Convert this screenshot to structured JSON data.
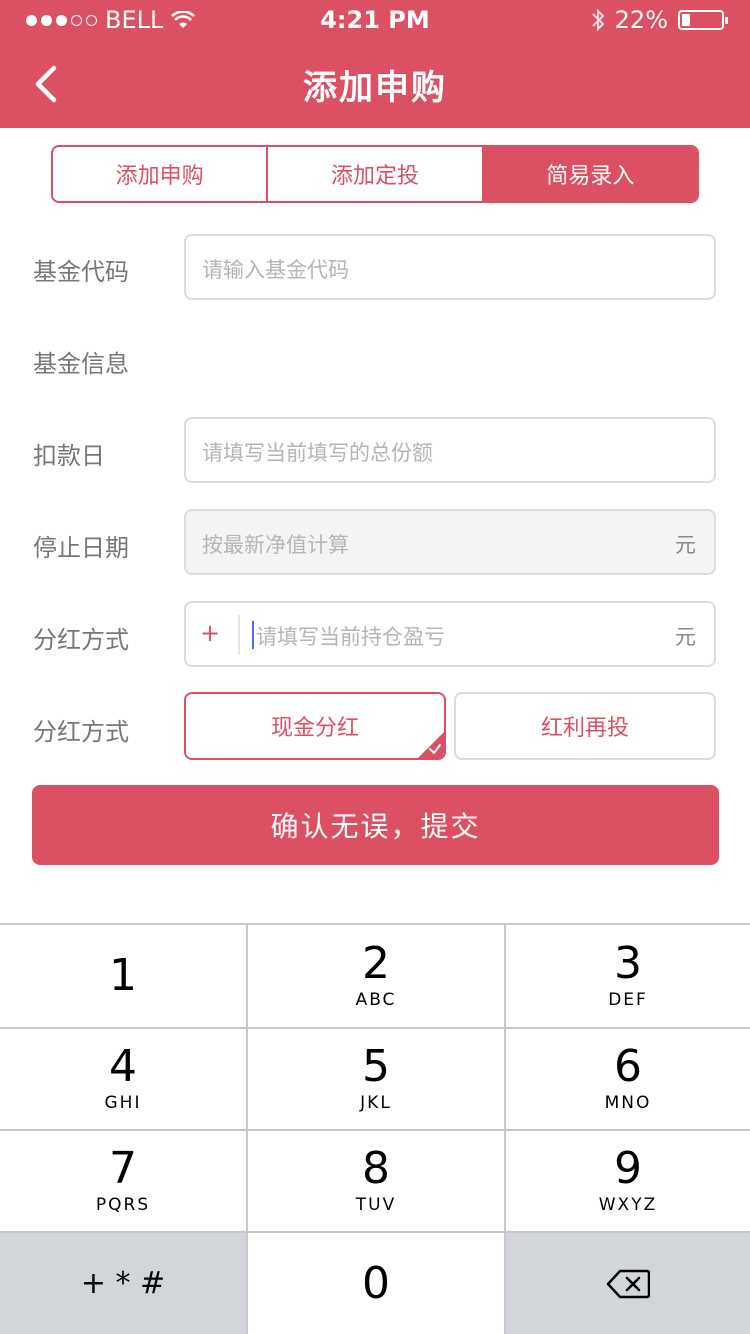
{
  "status_bar": {
    "carrier": "BELL",
    "time": "4:21 PM",
    "battery_text": "22%",
    "battery_level": 0.22
  },
  "nav": {
    "title": "添加申购"
  },
  "tabs": [
    {
      "label": "添加申购",
      "active": false
    },
    {
      "label": "添加定投",
      "active": false
    },
    {
      "label": "简易录入",
      "active": true
    }
  ],
  "form": {
    "fund_code_label": "基金代码",
    "fund_code_placeholder": "请输入基金代码",
    "fund_info_label": "基金信息",
    "debit_day_label": "扣款日",
    "debit_day_placeholder": "请填写当前填写的总份额",
    "stop_date_label": "停止日期",
    "stop_date_placeholder": "按最新净值计算",
    "stop_date_unit": "元",
    "dividend_label_1": "分红方式",
    "pnl_sign": "+",
    "pnl_placeholder": "请填写当前持仓盈亏",
    "pnl_unit": "元",
    "dividend_label_2": "分红方式",
    "dividend_options": [
      {
        "label": "现金分红",
        "selected": true
      },
      {
        "label": "红利再投",
        "selected": false
      }
    ]
  },
  "submit_label": "确认无误，提交",
  "keypad": {
    "keys": [
      {
        "num": "1",
        "sub": ""
      },
      {
        "num": "2",
        "sub": "ABC"
      },
      {
        "num": "3",
        "sub": "DEF"
      },
      {
        "num": "4",
        "sub": "GHI"
      },
      {
        "num": "5",
        "sub": "JKL"
      },
      {
        "num": "6",
        "sub": "MNO"
      },
      {
        "num": "7",
        "sub": "PQRS"
      },
      {
        "num": "8",
        "sub": "TUV"
      },
      {
        "num": "9",
        "sub": "WXYZ"
      }
    ],
    "symbols": "+ * #",
    "zero": "0"
  },
  "colors": {
    "accent": "#dc5064",
    "key_gray": "#d2d6db"
  }
}
